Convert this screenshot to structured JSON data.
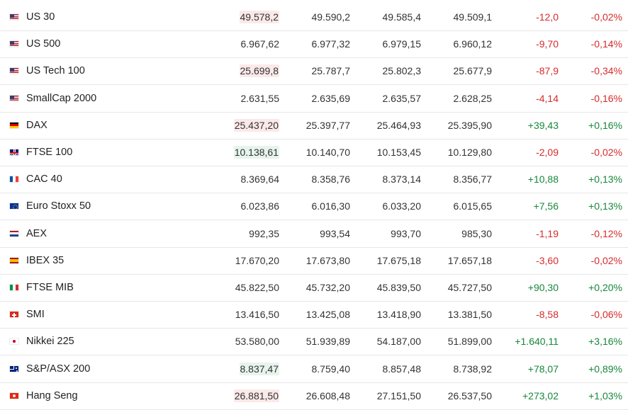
{
  "indices": [
    {
      "flag": "us-flag-icon",
      "name": "US 30",
      "last": "49.578,2",
      "open": "49.590,2",
      "high": "49.585,4",
      "low": "49.509,1",
      "change": "-12,0",
      "change_pct": "-0,02%",
      "direction": "neg",
      "last_highlight": "neg"
    },
    {
      "flag": "us-flag-icon",
      "name": "US 500",
      "last": "6.967,62",
      "open": "6.977,32",
      "high": "6.979,15",
      "low": "6.960,12",
      "change": "-9,70",
      "change_pct": "-0,14%",
      "direction": "neg",
      "last_highlight": "none"
    },
    {
      "flag": "us-flag-icon",
      "name": "US Tech 100",
      "last": "25.699,8",
      "open": "25.787,7",
      "high": "25.802,3",
      "low": "25.677,9",
      "change": "-87,9",
      "change_pct": "-0,34%",
      "direction": "neg",
      "last_highlight": "neg"
    },
    {
      "flag": "us-flag-icon",
      "name": "SmallCap 2000",
      "last": "2.631,55",
      "open": "2.635,69",
      "high": "2.635,57",
      "low": "2.628,25",
      "change": "-4,14",
      "change_pct": "-0,16%",
      "direction": "neg",
      "last_highlight": "none"
    },
    {
      "flag": "germany-flag-icon",
      "name": "DAX",
      "last": "25.437,20",
      "open": "25.397,77",
      "high": "25.464,93",
      "low": "25.395,90",
      "change": "+39,43",
      "change_pct": "+0,16%",
      "direction": "pos",
      "last_highlight": "neg"
    },
    {
      "flag": "uk-flag-icon",
      "name": "FTSE 100",
      "last": "10.138,61",
      "open": "10.140,70",
      "high": "10.153,45",
      "low": "10.129,80",
      "change": "-2,09",
      "change_pct": "-0,02%",
      "direction": "neg",
      "last_highlight": "pos"
    },
    {
      "flag": "france-flag-icon",
      "name": "CAC 40",
      "last": "8.369,64",
      "open": "8.358,76",
      "high": "8.373,14",
      "low": "8.356,77",
      "change": "+10,88",
      "change_pct": "+0,13%",
      "direction": "pos",
      "last_highlight": "none"
    },
    {
      "flag": "eu-flag-icon",
      "name": "Euro Stoxx 50",
      "last": "6.023,86",
      "open": "6.016,30",
      "high": "6.033,20",
      "low": "6.015,65",
      "change": "+7,56",
      "change_pct": "+0,13%",
      "direction": "pos",
      "last_highlight": "none"
    },
    {
      "flag": "netherlands-flag-icon",
      "name": "AEX",
      "last": "992,35",
      "open": "993,54",
      "high": "993,70",
      "low": "985,30",
      "change": "-1,19",
      "change_pct": "-0,12%",
      "direction": "neg",
      "last_highlight": "none"
    },
    {
      "flag": "spain-flag-icon",
      "name": "IBEX 35",
      "last": "17.670,20",
      "open": "17.673,80",
      "high": "17.675,18",
      "low": "17.657,18",
      "change": "-3,60",
      "change_pct": "-0,02%",
      "direction": "neg",
      "last_highlight": "none"
    },
    {
      "flag": "italy-flag-icon",
      "name": "FTSE MIB",
      "last": "45.822,50",
      "open": "45.732,20",
      "high": "45.839,50",
      "low": "45.727,50",
      "change": "+90,30",
      "change_pct": "+0,20%",
      "direction": "pos",
      "last_highlight": "none"
    },
    {
      "flag": "switzerland-flag-icon",
      "name": "SMI",
      "last": "13.416,50",
      "open": "13.425,08",
      "high": "13.418,90",
      "low": "13.381,50",
      "change": "-8,58",
      "change_pct": "-0,06%",
      "direction": "neg",
      "last_highlight": "none"
    },
    {
      "flag": "japan-flag-icon",
      "name": "Nikkei 225",
      "last": "53.580,00",
      "open": "51.939,89",
      "high": "54.187,00",
      "low": "51.899,00",
      "change": "+1.640,11",
      "change_pct": "+3,16%",
      "direction": "pos",
      "last_highlight": "none"
    },
    {
      "flag": "australia-flag-icon",
      "name": "S&P/ASX 200",
      "last": "8.837,47",
      "open": "8.759,40",
      "high": "8.857,48",
      "low": "8.738,92",
      "change": "+78,07",
      "change_pct": "+0,89%",
      "direction": "pos",
      "last_highlight": "pos"
    },
    {
      "flag": "hong-kong-flag-icon",
      "name": "Hang Seng",
      "last": "26.881,50",
      "open": "26.608,48",
      "high": "27.151,50",
      "low": "26.537,50",
      "change": "+273,02",
      "change_pct": "+1,03%",
      "direction": "pos",
      "last_highlight": "neg"
    }
  ],
  "colors": {
    "negative": "#d62b2b",
    "positive": "#17873a",
    "negative_highlight": "#fbe9e9",
    "positive_highlight": "#e7f4ec",
    "row_border": "#e7e7e7"
  }
}
